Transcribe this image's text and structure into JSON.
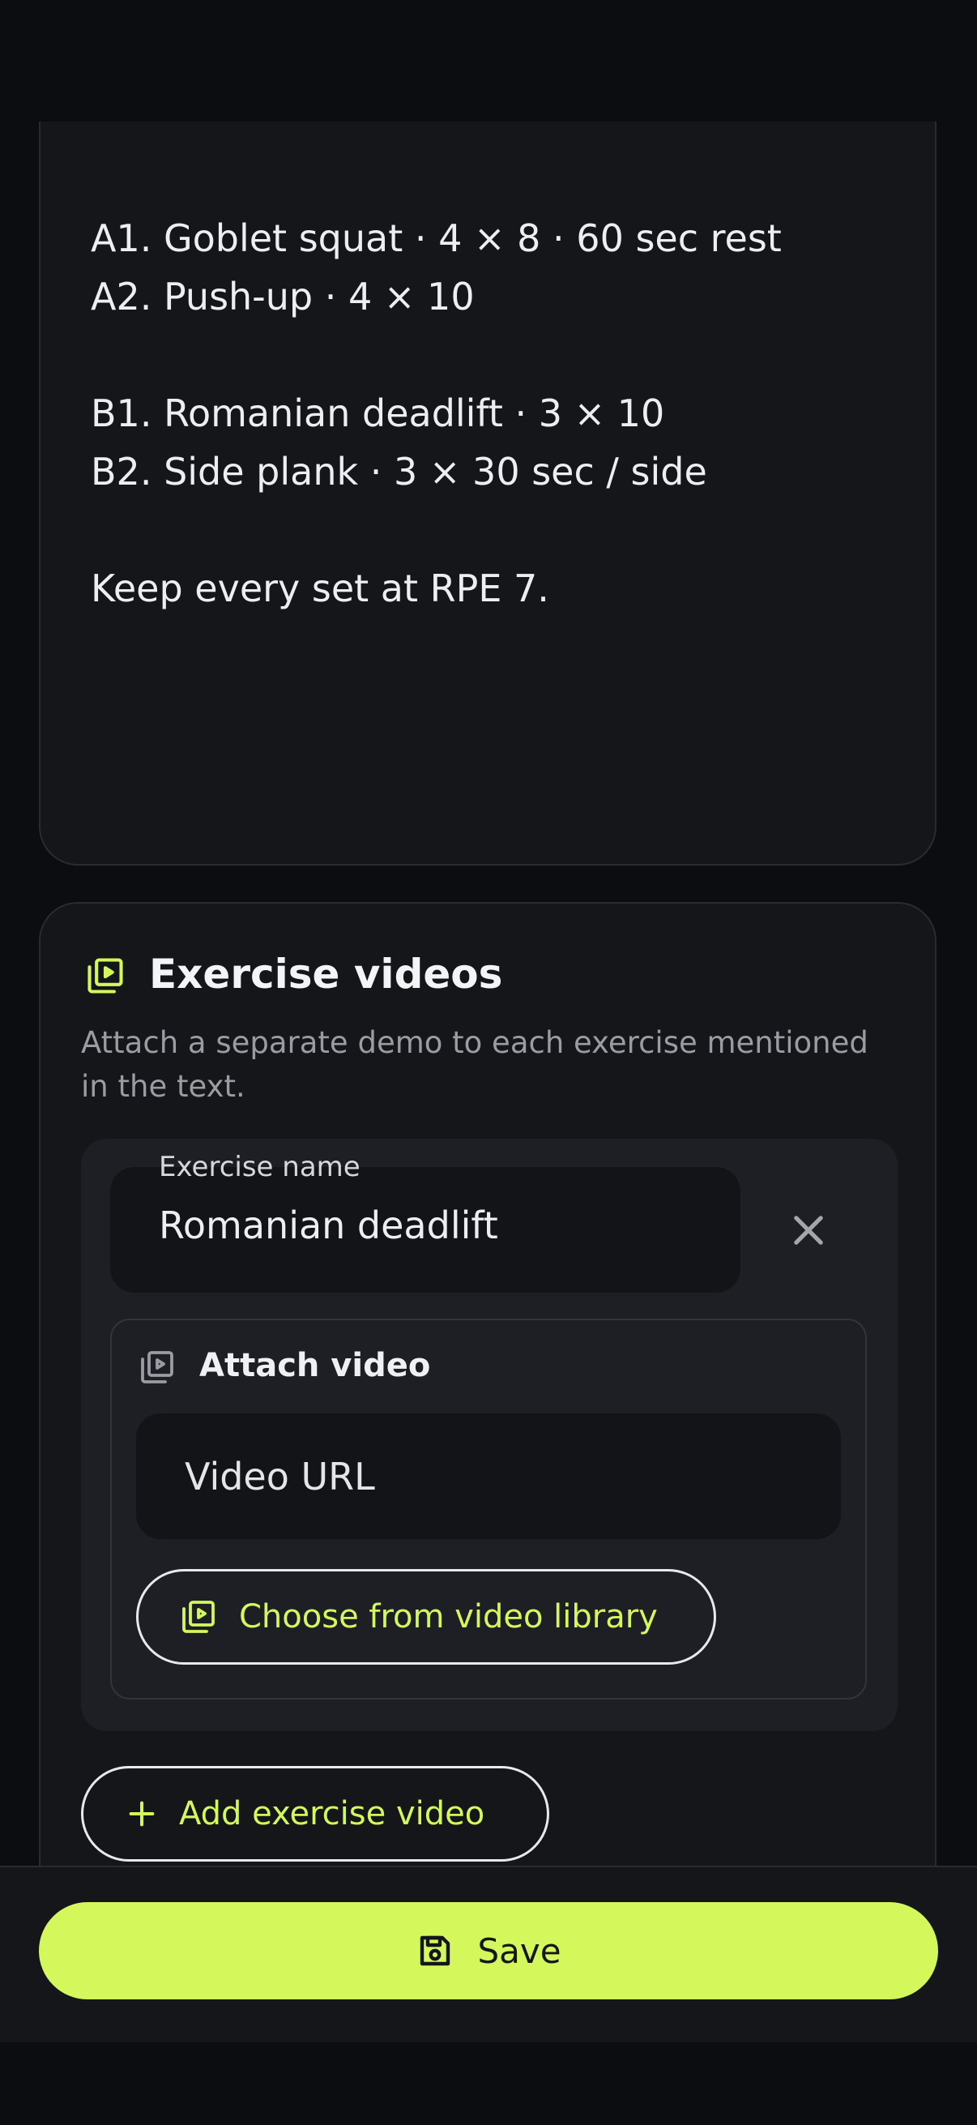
{
  "workout_text": "A1. Goblet squat · 4 × 8 · 60 sec rest\nA2. Push-up · 4 × 10\n\nB1. Romanian deadlift · 3 × 10\nB2. Side plank · 3 × 30 sec / side\n\nKeep every set at RPE 7.",
  "exercise_videos": {
    "title": "Exercise videos",
    "description": "Attach a separate demo to each exercise mentioned in the text.",
    "icon": "video-library-icon",
    "items": [
      {
        "name_label": "Exercise name",
        "name_value": "Romanian deadlift",
        "attach_title": "Attach video",
        "url_placeholder": "Video URL",
        "library_button_label": "Choose from video library"
      }
    ],
    "add_button_label": "Add exercise video"
  },
  "footer": {
    "save_label": "Save"
  },
  "colors": {
    "accent": "#d4f75c",
    "background": "#0c0d10",
    "card": "#151619",
    "panel": "#1e1f24"
  }
}
